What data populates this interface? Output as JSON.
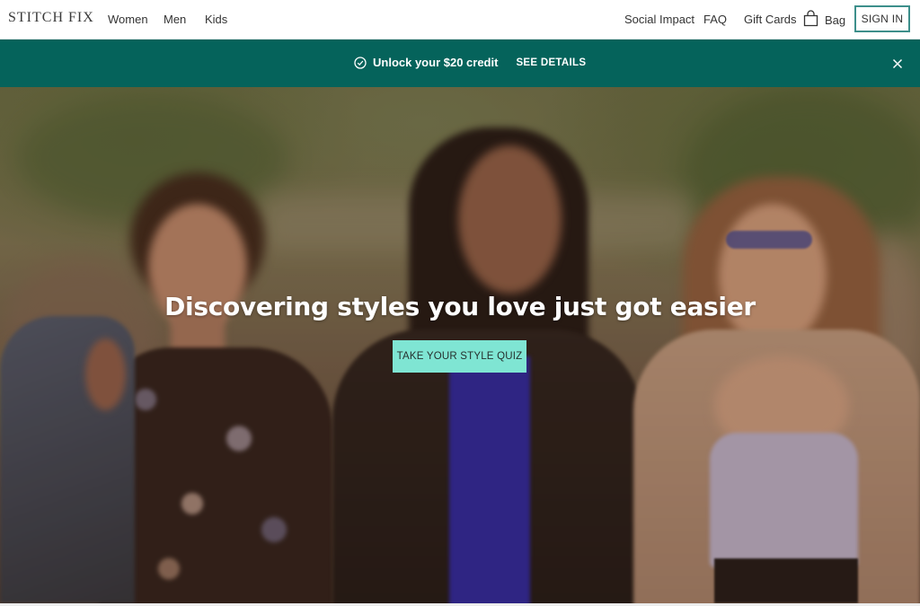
{
  "nav": {
    "logo": "STITCH FIX",
    "left_links": [
      {
        "label": "Women"
      },
      {
        "label": "Men"
      },
      {
        "label": "Kids"
      }
    ],
    "right_links": [
      {
        "label": "Social Impact"
      },
      {
        "label": "FAQ"
      },
      {
        "label": "Gift Cards"
      }
    ],
    "bag": {
      "label": "Bag",
      "icon": "shopping-bag-icon"
    },
    "sign_in_label": "SIGN IN"
  },
  "promo": {
    "icon": "check-circle-icon",
    "text": "Unlock your $20 credit",
    "link_label": "SEE DETAILS",
    "close_icon": "close-icon",
    "background": "#05635b"
  },
  "hero": {
    "title": "Discovering styles you love just got easier",
    "cta_label": "TAKE YOUR STYLE QUIZ",
    "cta_color": "#7fe5d3",
    "image_description": "Three women walking outdoors in a park"
  },
  "colors": {
    "accent": "#3d8f8b",
    "banner": "#05635b",
    "cta": "#7fe5d3"
  }
}
